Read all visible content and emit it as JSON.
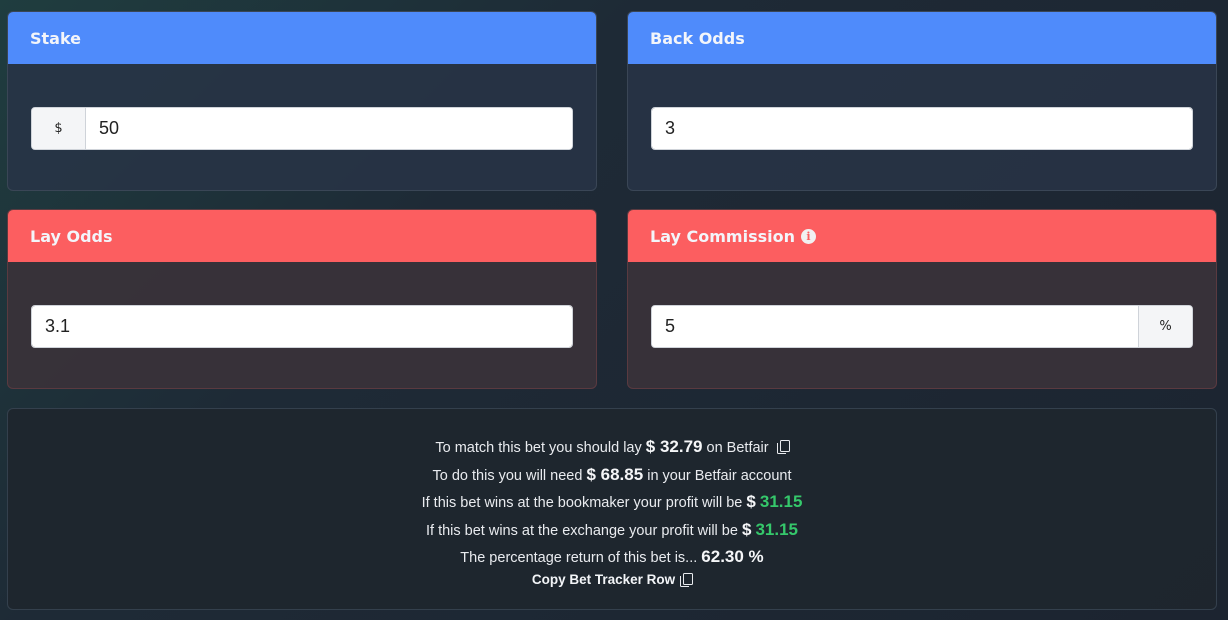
{
  "stake": {
    "label": "Stake",
    "prefix": "$",
    "value": "50"
  },
  "back_odds": {
    "label": "Back Odds",
    "value": "3"
  },
  "lay_odds": {
    "label": "Lay Odds",
    "value": "3.1"
  },
  "lay_commission": {
    "label": "Lay Commission",
    "info_glyph": "i",
    "value": "5",
    "suffix": "%"
  },
  "results": {
    "line1": {
      "pre": "To match this bet you should lay ",
      "amount": "$ 32.79",
      "post": " on Betfair"
    },
    "line2": {
      "pre": "To do this you will need ",
      "amount": "$ 68.85",
      "post": " in your Betfair account"
    },
    "line3": {
      "pre": "If this bet wins at the bookmaker your profit will be ",
      "currency": "$",
      "amount": "31.15"
    },
    "line4": {
      "pre": "If this bet wins at the exchange your profit will be ",
      "currency": "$",
      "amount": "31.15"
    },
    "line5": {
      "pre": "The percentage return of this bet is... ",
      "amount": "62.30 %"
    },
    "copy_tracker_label": "Copy Bet Tracker Row"
  },
  "colors": {
    "blue_header": "#4f8bfb",
    "red_header": "#fc5e60",
    "profit_green": "#35c86b"
  },
  "icons": [
    "info-icon",
    "copy-icon"
  ]
}
